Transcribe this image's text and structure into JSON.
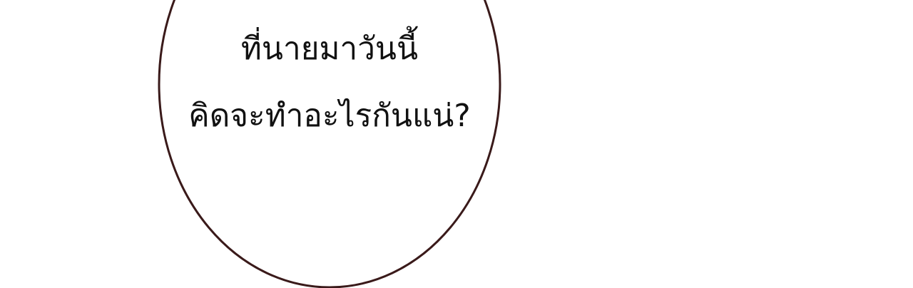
{
  "speech_bubble": {
    "lines": [
      "ที่นายมาวันนี้",
      "คิดจะทำอะไรกันแน่?"
    ],
    "outline_color": "#3a1a1a",
    "fill_color": "#ffffff",
    "text_color": "#111111"
  }
}
